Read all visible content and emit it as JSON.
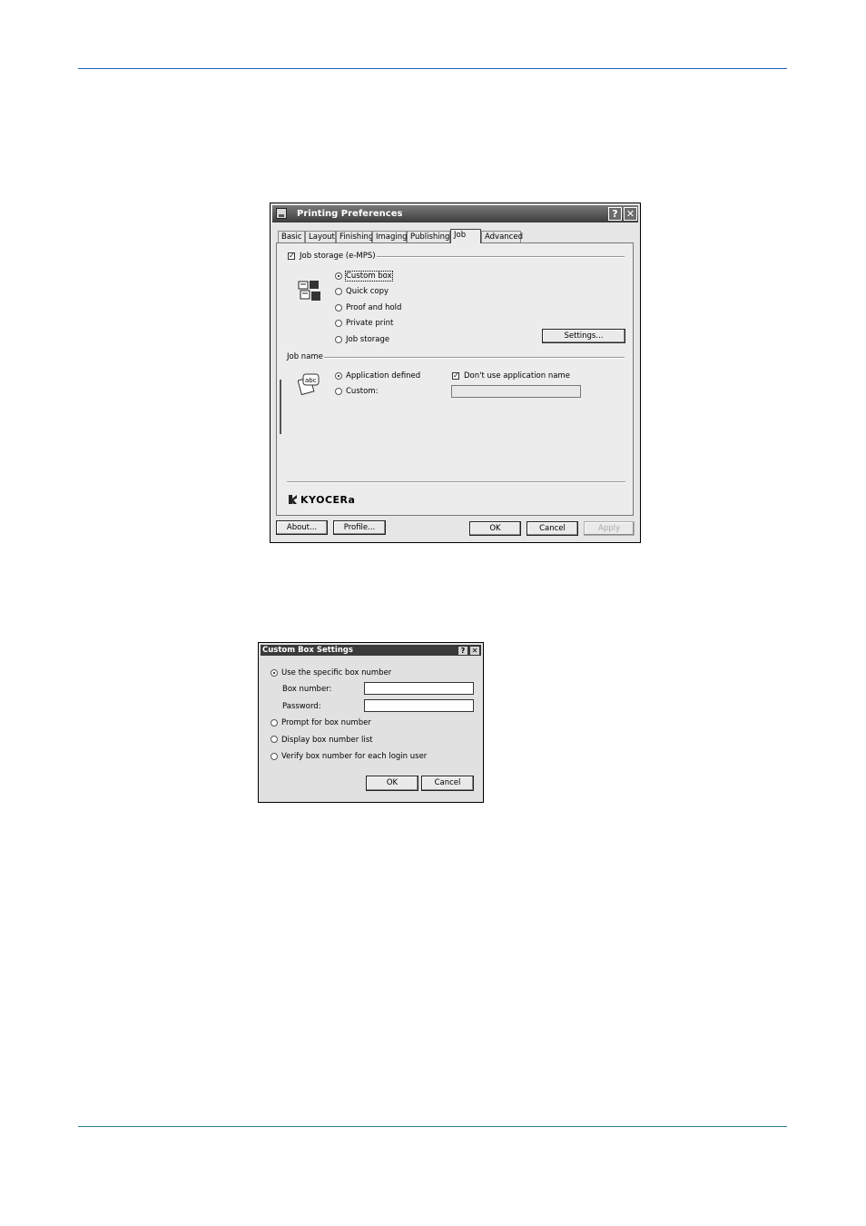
{
  "printing_preferences": {
    "title": "Printing Preferences",
    "help_btn": "?",
    "close_btn": "✕",
    "tabs": [
      "Basic",
      "Layout",
      "Finishing",
      "Imaging",
      "Publishing",
      "Job",
      "Advanced"
    ],
    "active_tab": "Job",
    "job_storage_label": "Job storage (e-MPS)",
    "job_storage_checked": true,
    "storage_options": [
      {
        "label": "Custom box",
        "selected": true
      },
      {
        "label": "Quick copy",
        "selected": false
      },
      {
        "label": "Proof and hold",
        "selected": false
      },
      {
        "label": "Private print",
        "selected": false
      },
      {
        "label": "Job storage",
        "selected": false
      }
    ],
    "settings_button": "Settings...",
    "job_name_label": "Job name",
    "job_name_options": [
      {
        "label": "Application defined",
        "selected": true
      },
      {
        "label": "Custom:",
        "selected": false
      }
    ],
    "dont_use_app_name_label": "Don't use application name",
    "dont_use_app_name_checked": true,
    "custom_name_value": "",
    "logo_text": "KYOCERa",
    "buttons": {
      "about": "About...",
      "profile": "Profile...",
      "ok": "OK",
      "cancel": "Cancel",
      "apply": "Apply"
    },
    "icons": {
      "storage": "job-storage-icon",
      "job_name": "abc-document-icon",
      "app": "printer-icon"
    }
  },
  "custom_box_settings": {
    "title": "Custom Box Settings",
    "help_btn": "?",
    "close_btn": "✕",
    "options": [
      {
        "label": "Use the specific box number",
        "selected": true
      },
      {
        "label": "Prompt for box number",
        "selected": false
      },
      {
        "label": "Display box number list",
        "selected": false
      },
      {
        "label": "Verify box number for each login user",
        "selected": false
      }
    ],
    "box_number_label": "Box number:",
    "box_number_value": "",
    "password_label": "Password:",
    "password_value": "",
    "buttons": {
      "ok": "OK",
      "cancel": "Cancel"
    }
  }
}
